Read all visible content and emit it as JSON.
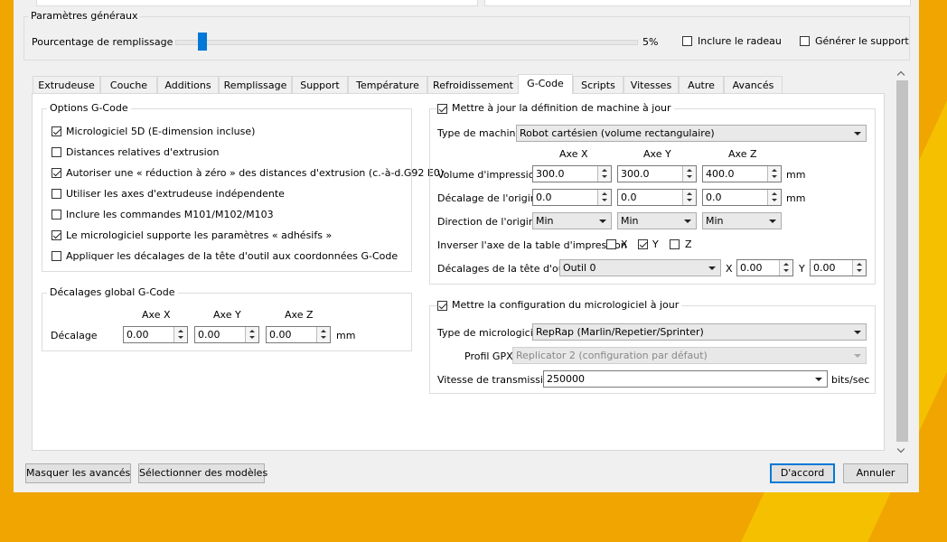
{
  "general": {
    "title": "Paramètres généraux",
    "infill_label": "Pourcentage de remplissage :",
    "infill_value": "5%",
    "infill_fraction": 0.05,
    "raft_label": "Inclure le radeau",
    "raft_checked": false,
    "support_label": "Générer le support",
    "support_checked": false
  },
  "tabs": [
    {
      "label": "Extrudeuse"
    },
    {
      "label": "Couche"
    },
    {
      "label": "Additions"
    },
    {
      "label": "Remplissage"
    },
    {
      "label": "Support"
    },
    {
      "label": "Température"
    },
    {
      "label": "Refroidissement"
    },
    {
      "label": "G-Code",
      "active": true
    },
    {
      "label": "Scripts"
    },
    {
      "label": "Vitesses"
    },
    {
      "label": "Autre"
    },
    {
      "label": "Avancés"
    }
  ],
  "gcode_options": {
    "title": "Options G-Code",
    "items": [
      {
        "label": "Micrologiciel 5D (E-dimension incluse)",
        "checked": true
      },
      {
        "label": "Distances relatives d'extrusion",
        "checked": false
      },
      {
        "label": "Autoriser une « réduction à zéro » des distances d'extrusion (c.-à-d.G92 E0)",
        "checked": true
      },
      {
        "label": "Utiliser les axes d'extrudeuse indépendente",
        "checked": false
      },
      {
        "label": "Inclure les commandes M101/M102/M103",
        "checked": false
      },
      {
        "label": "Le micrologiciel supporte les paramètres « adhésifs »",
        "checked": true
      },
      {
        "label": "Appliquer les décalages de la tête d'outil aux coordonnées G-Code",
        "checked": false
      }
    ]
  },
  "global_offsets": {
    "title": "Décalages global G-Code",
    "col_x": "Axe X",
    "col_y": "Axe Y",
    "col_z": "Axe Z",
    "row_label": "Décalage",
    "x": "0.00",
    "y": "0.00",
    "z": "0.00",
    "unit": "mm"
  },
  "machine": {
    "title": "Mettre à jour la définition de machine à jour",
    "enabled": true,
    "type_label": "Type de machine",
    "type_value": "Robot cartésien (volume rectangulaire)",
    "col_x": "Axe X",
    "col_y": "Axe Y",
    "col_z": "Axe Z",
    "volume_label": "Volume d'impression",
    "volume": [
      "300.0",
      "300.0",
      "400.0"
    ],
    "origin_offset_label": "Décalage de l'origine",
    "origin_offset": [
      "0.0",
      "0.0",
      "0.0"
    ],
    "origin_dir_label": "Direction de l'origine",
    "origin_dir": [
      "Min",
      "Min",
      "Min"
    ],
    "unit": "mm",
    "invert_label": "Inverser l'axe de la table d'impression",
    "invert_x_label": "X",
    "invert_y_label": "Y",
    "invert_z_label": "Z",
    "invert_x": false,
    "invert_y": true,
    "invert_z": false,
    "toolhead_label": "Décalages de la tête d'outil",
    "toolhead_value": "Outil 0",
    "toolhead_x_label": "X",
    "toolhead_x": "0.00",
    "toolhead_y_label": "Y",
    "toolhead_y": "0.00"
  },
  "firmware": {
    "title": "Mettre la configuration du micrologiciel à jour",
    "enabled": true,
    "type_label": "Type de micrologiciel",
    "type_value": "RepRap (Marlin/Repetier/Sprinter)",
    "gpx_label": "Profil GPX",
    "gpx_value": "Replicator 2 (configuration par défaut)",
    "baud_label": "Vitesse de transmission",
    "baud_value": "250000",
    "baud_unit": "bits/sec"
  },
  "buttons": {
    "hide_advanced": "Masquer les avancés",
    "select_models": "Sélectionner des modèles",
    "ok": "D'accord",
    "cancel": "Annuler"
  },
  "colors": {
    "accent": "#0078d7",
    "background": "#f0a500"
  }
}
